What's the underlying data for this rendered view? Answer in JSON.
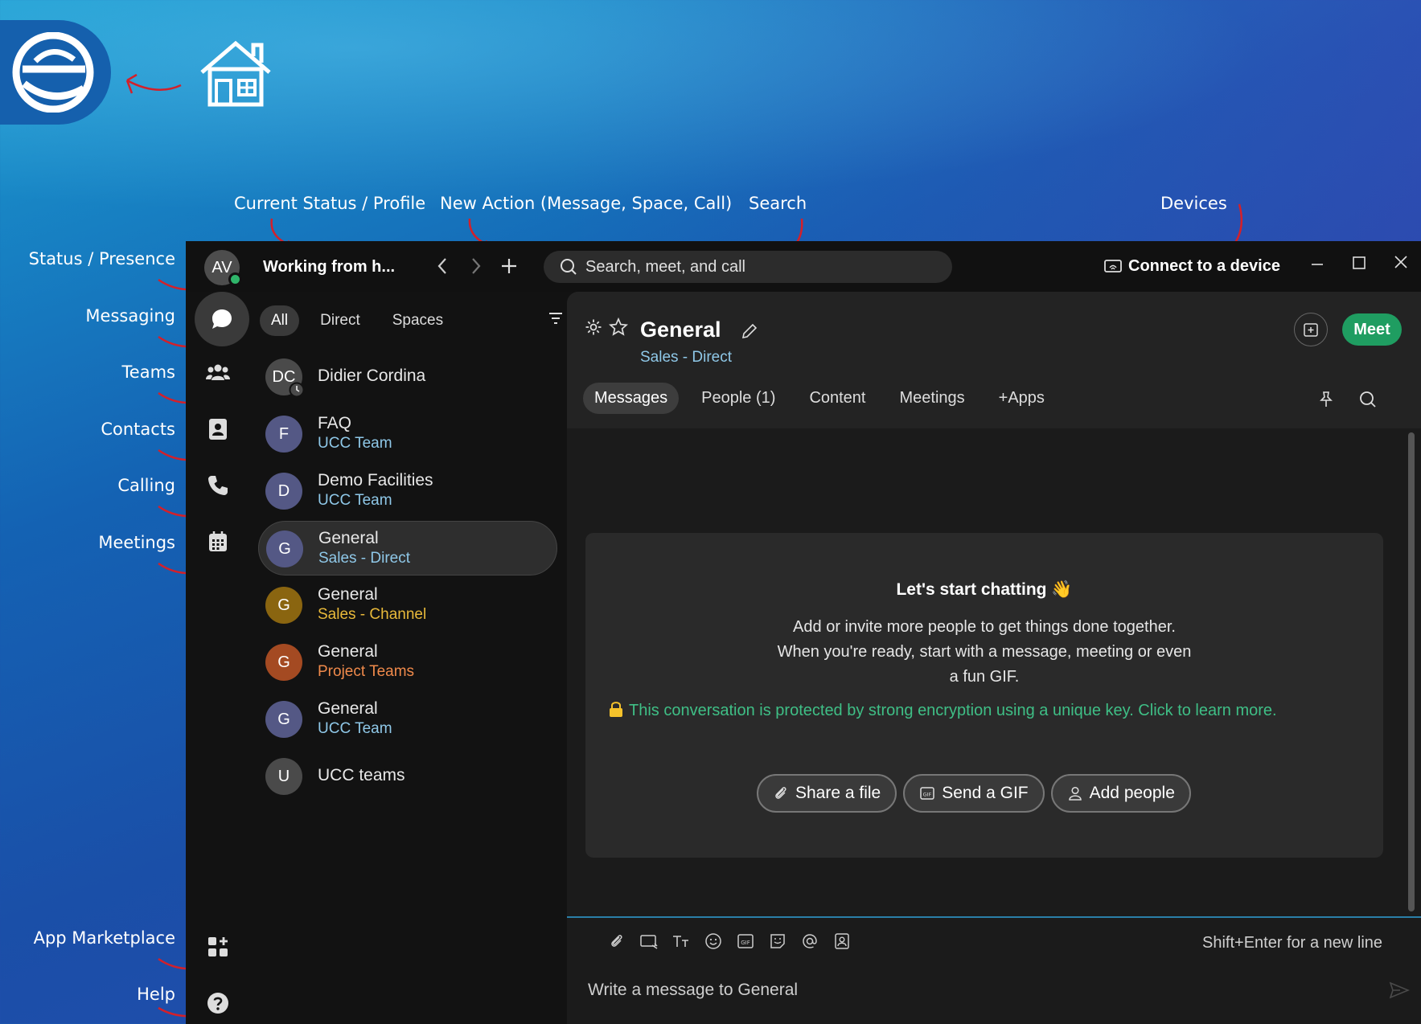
{
  "annotations": {
    "top": {
      "current_status": "Current Status / Profile",
      "new_action": "New Action (Message, Space, Call)",
      "search": "Search",
      "devices": "Devices"
    },
    "left": {
      "status_presence": "Status / Presence",
      "messaging": "Messaging",
      "teams": "Teams",
      "contacts": "Contacts",
      "calling": "Calling",
      "meetings": "Meetings",
      "app_marketplace": "App Marketplace",
      "help": "Help"
    }
  },
  "titlebar": {
    "avatar_initials": "AV",
    "status_text": "Working from h...",
    "search_placeholder": "Search, meet, and call",
    "connect_device": "Connect to a device"
  },
  "filters": {
    "all": "All",
    "direct": "Direct",
    "spaces": "Spaces"
  },
  "conversations": [
    {
      "initials": "DC",
      "title": "Didier Cordina",
      "subtitle": ""
    },
    {
      "initials": "F",
      "title": "FAQ",
      "subtitle": "UCC Team"
    },
    {
      "initials": "D",
      "title": "Demo Facilities",
      "subtitle": "UCC Team"
    },
    {
      "initials": "G",
      "title": "General",
      "subtitle": "Sales - Direct"
    },
    {
      "initials": "G",
      "title": "General",
      "subtitle": "Sales - Channel"
    },
    {
      "initials": "G",
      "title": "General",
      "subtitle": "Project Teams"
    },
    {
      "initials": "G",
      "title": "General",
      "subtitle": "UCC Team"
    },
    {
      "initials": "U",
      "title": "UCC teams",
      "subtitle": ""
    }
  ],
  "space": {
    "title": "General",
    "subtitle": "Sales - Direct",
    "meet_label": "Meet",
    "tabs": [
      "Messages",
      "People (1)",
      "Content",
      "Meetings",
      "+Apps"
    ]
  },
  "empty_state": {
    "title": "Let's start chatting 👋",
    "body_line1": "Add or invite more people to get things done together.",
    "body_line2": "When you're ready, start with a message, meeting or even",
    "body_line3": "a fun GIF.",
    "encryption": "This conversation is protected by strong encryption using a unique key. Click to learn more.",
    "share_file": "Share a file",
    "send_gif": "Send a GIF",
    "add_people": "Add people"
  },
  "compose": {
    "hint": "Shift+Enter for a new line",
    "placeholder": "Write a message to General"
  },
  "colors": {
    "accent_green": "#1f9d61",
    "encryption_text": "#3fbf86",
    "annotation_arrow": "#d4202a",
    "space_subtitle_blue": "#8fc8e8",
    "channel_yellow": "#e8b93a",
    "project_orange": "#f08a4b"
  }
}
